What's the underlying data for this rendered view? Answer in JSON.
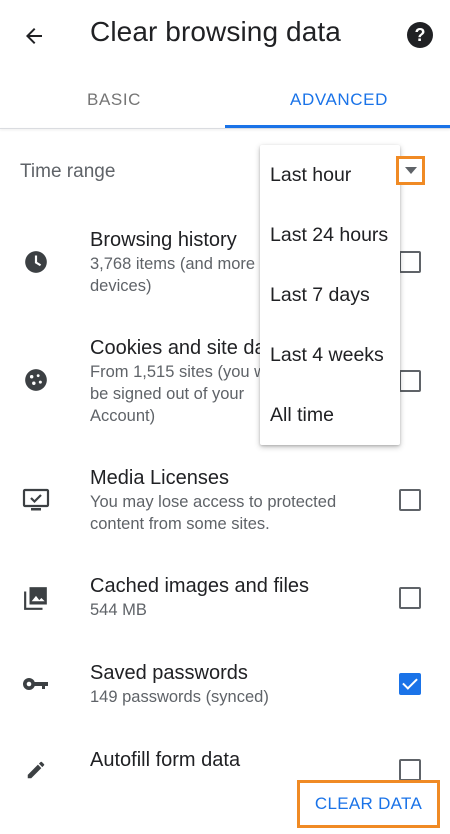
{
  "header": {
    "title": "Clear browsing data"
  },
  "tabs": [
    {
      "label": "BASIC"
    },
    {
      "label": "ADVANCED"
    }
  ],
  "time_range": {
    "label": "Time range",
    "selected": "Last hour",
    "options": [
      "Last hour",
      "Last 24 hours",
      "Last 7 days",
      "Last 4 weeks",
      "All time"
    ]
  },
  "items": [
    {
      "title": "Browsing history",
      "subtitle": "3,768 items (and more devices)",
      "checked": false,
      "icon": "clock-icon"
    },
    {
      "title": "Cookies and site da",
      "subtitle": "From 1,515 sites (you w be signed out of your Account)",
      "checked": false,
      "icon": "cookie-icon"
    },
    {
      "title": "Media Licenses",
      "subtitle": "You may lose access to protected content from some sites.",
      "checked": false,
      "icon": "media-license-icon"
    },
    {
      "title": "Cached images and files",
      "subtitle": "544 MB",
      "checked": false,
      "icon": "images-icon"
    },
    {
      "title": "Saved passwords",
      "subtitle": "149 passwords (synced)",
      "checked": true,
      "icon": "key-icon"
    },
    {
      "title": "Autofill form data",
      "subtitle": "",
      "checked": false,
      "icon": "pencil-icon"
    }
  ],
  "footer": {
    "clear_label": "CLEAR DATA"
  },
  "colors": {
    "accent": "#1a73e8",
    "highlight": "#f08a24",
    "text": "#202124",
    "secondary": "#5f6368"
  }
}
